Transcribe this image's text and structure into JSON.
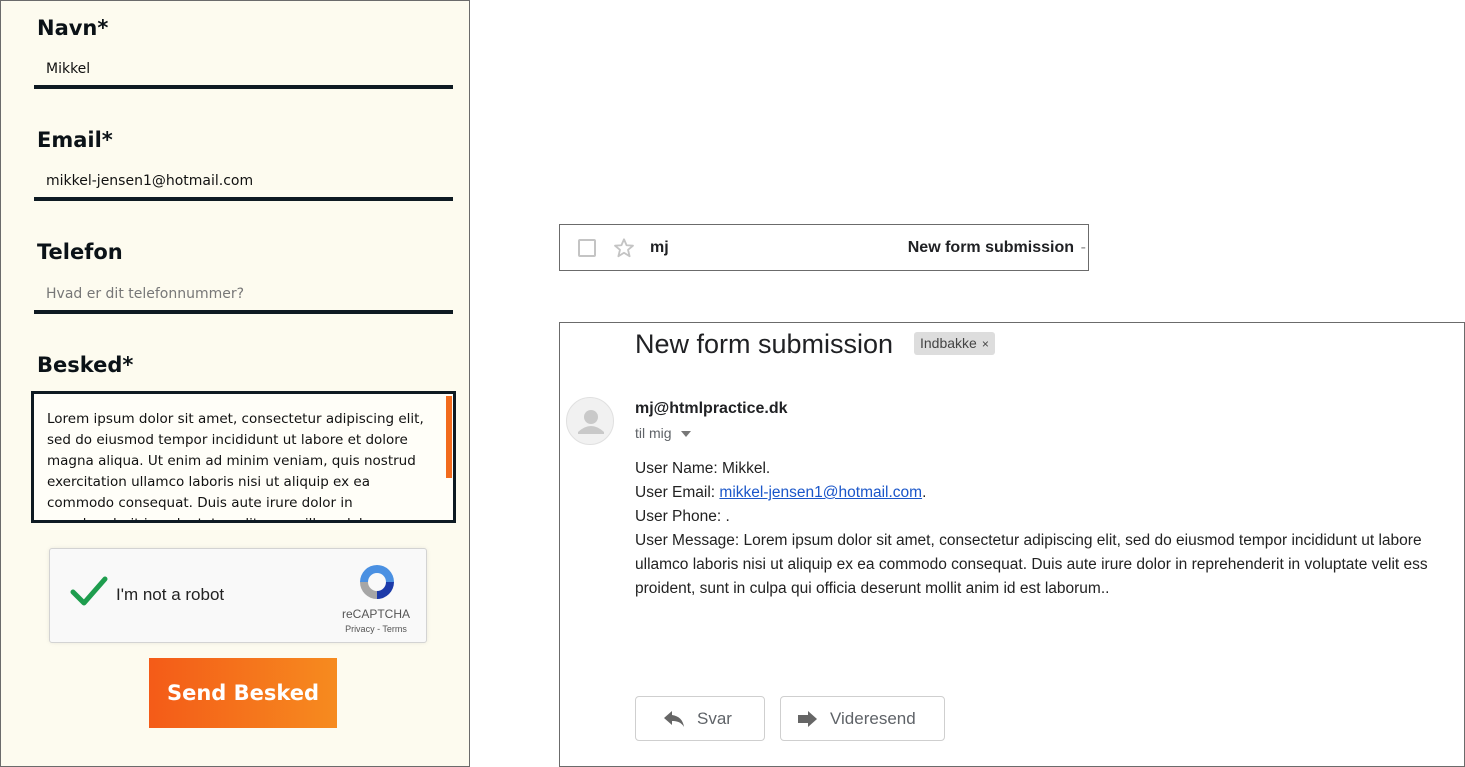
{
  "form": {
    "name_label": "Navn*",
    "name_value": "Mikkel",
    "email_label": "Email*",
    "email_value": "mikkel-jensen1@hotmail.com",
    "phone_label": "Telefon",
    "phone_placeholder": "Hvad er dit telefonnummer?",
    "message_label": "Besked*",
    "message_text": "Lorem ipsum dolor sit amet, consectetur adipiscing elit, sed do eiusmod tempor incididunt ut labore et dolore magna aliqua. Ut enim ad minim veniam, quis nostrud exercitation ullamco laboris nisi ut aliquip ex ea commodo consequat. Duis aute irure dolor in reprehenderit in voluptate velit esse cillum dolore eu fugiat nulla pariatur. Excepteur sint occaecat cupidatat non proident, sunt in culpa qui officia deserunt mollit anim id est laborum.",
    "recaptcha_label": "I'm not a robot",
    "recaptcha_brand": "reCAPTCHA",
    "recaptcha_privacy": "Privacy",
    "recaptcha_sep": " - ",
    "recaptcha_terms": "Terms",
    "send_label": "Send Besked",
    "accent_color": "#f45b18"
  },
  "inbox_row": {
    "sender": "mj",
    "subject": "New form submission",
    "dash": "-"
  },
  "email": {
    "subject": "New form submission",
    "label_chip": "Indbakke",
    "chip_close": "×",
    "from": "mj@htmlpractice.dk",
    "to": "til mig",
    "body_name": "User Name: Mikkel.",
    "body_email_prefix": "User Email: ",
    "body_email_link": "mikkel-jensen1@hotmail.com",
    "body_email_suffix": ".",
    "body_phone": "User Phone: .",
    "body_message_1": "User Message: Lorem ipsum dolor sit amet, consectetur adipiscing elit, sed do eiusmod tempor incididunt ut labore",
    "body_message_2": "ullamco laboris nisi ut aliquip ex ea commodo consequat. Duis aute irure dolor in reprehenderit in voluptate velit ess",
    "body_message_3": "proident, sunt in culpa qui officia deserunt mollit anim id est laborum..",
    "reply_label": "Svar",
    "forward_label": "Videresend",
    "link_color": "#1a56c9"
  },
  "icons": [
    "check-icon",
    "recaptcha-logo-icon",
    "checkbox-icon",
    "star-icon",
    "avatar-icon",
    "caret-down-icon",
    "reply-icon",
    "forward-icon"
  ]
}
